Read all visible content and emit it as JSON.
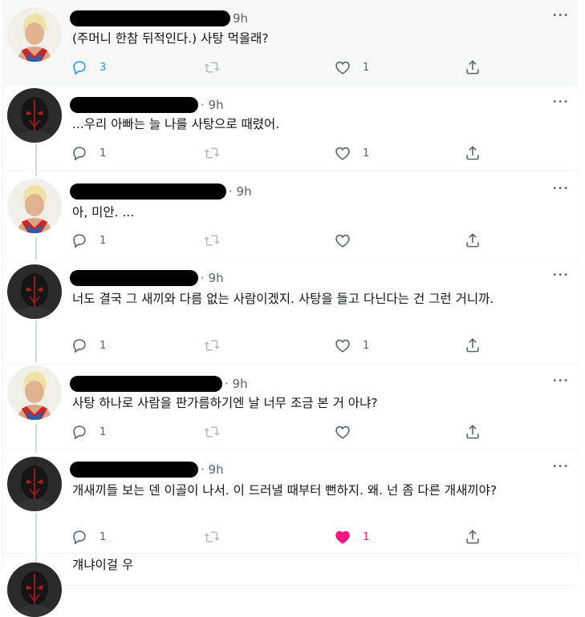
{
  "tweets": [
    {
      "text": "(주머니 한참 뒤적인다.) 사탕 먹을래?",
      "time": "9h",
      "replies": "3",
      "likes": "1",
      "liked": false,
      "author": "cody"
    },
    {
      "text": "...우리 아빠는 늘 나를 사탕으로 때렸어.",
      "time": "· 9h",
      "replies": "1",
      "likes": "1",
      "liked": false,
      "author": "finn"
    },
    {
      "text": "아, 미안. ...",
      "time": "· 9h",
      "replies": "1",
      "likes": "",
      "liked": false,
      "author": "cody"
    },
    {
      "text": "너도 결국 그 새끼와 다름 없는 사람이겠지. 사탕을 들고 다닌다는 건 그런 거니까.",
      "time": "· 9h",
      "replies": "1",
      "likes": "1",
      "liked": false,
      "author": "finn"
    },
    {
      "text": "사탕 하나로 사람을 판가름하기엔 날 너무 조금 본 거 아냐?",
      "time": "· 9h",
      "replies": "1",
      "likes": "",
      "liked": false,
      "author": "cody"
    },
    {
      "text": "개새끼들 보는 덴 이골이 나서. 이 드러낼 때부터 뻔하지. 왜. 넌 좀 다른 개새끼야?",
      "time": "· 9h",
      "replies": "1",
      "likes": "1",
      "liked": true,
      "author": "finn"
    },
    {
      "text": "걔냐이걸 우",
      "author": "finn"
    }
  ],
  "icons": {
    "reply": "reply-icon",
    "retweet": "retweet-icon",
    "like": "heart-icon",
    "share": "share-icon",
    "more": "more-icon"
  },
  "colors": {
    "muted": "#536471",
    "accent": "#1d9bf0",
    "like": "#f91880",
    "thread_line": "#cfd9de"
  }
}
